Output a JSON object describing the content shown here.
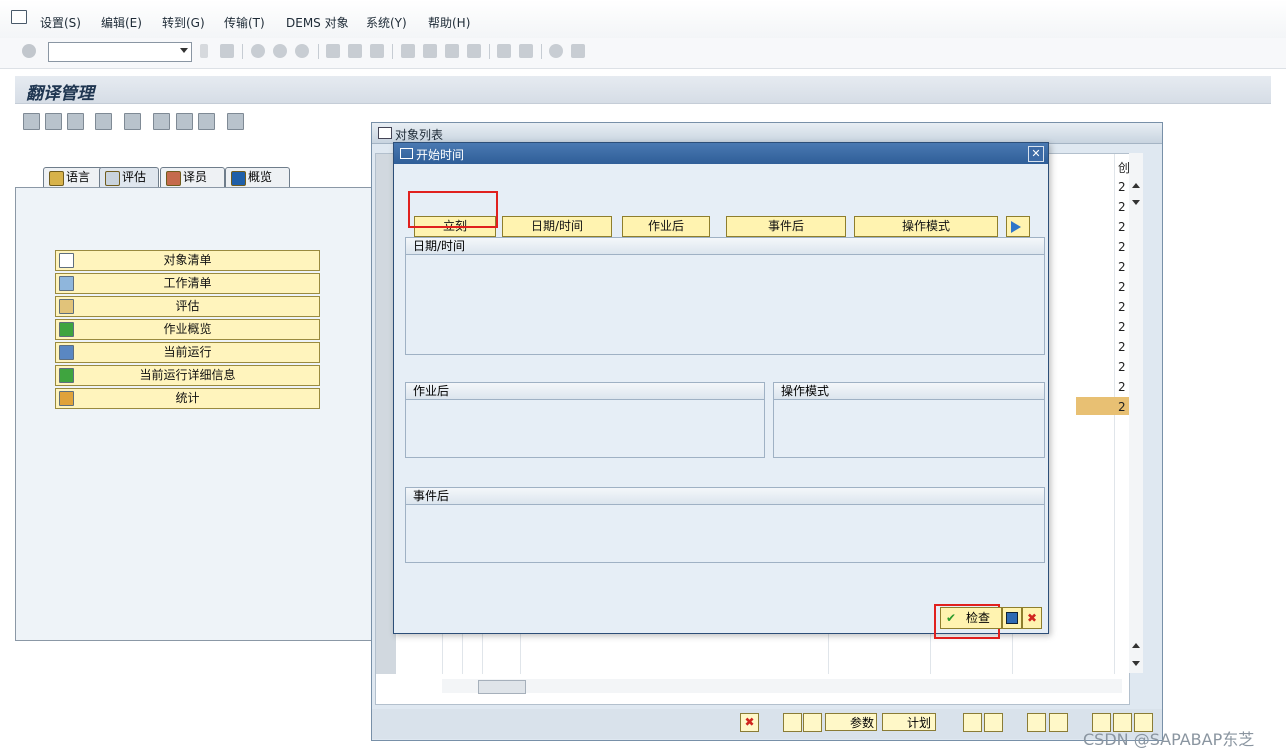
{
  "menu": {
    "items": [
      "设置(S)",
      "编辑(E)",
      "转到(G)",
      "传输(T)",
      "DEMS 对象",
      "系统(Y)",
      "帮助(H)"
    ]
  },
  "window": {
    "title": "翻译管理"
  },
  "tabs": [
    {
      "label": "语言",
      "icon": "language-icon"
    },
    {
      "label": "评估",
      "icon": "evaluation-icon"
    },
    {
      "label": "译员",
      "icon": "translators-icon"
    },
    {
      "label": "概览",
      "icon": "info-icon"
    }
  ],
  "nav": [
    {
      "label": "对象清单",
      "icon": "document-icon"
    },
    {
      "label": "工作清单",
      "icon": "worklist-icon"
    },
    {
      "label": "评估",
      "icon": "evaluation-icon"
    },
    {
      "label": "作业概览",
      "icon": "job-icon"
    },
    {
      "label": "当前运行",
      "icon": "run-icon"
    },
    {
      "label": "当前运行详细信息",
      "icon": "run-details-icon"
    },
    {
      "label": "统计",
      "icon": "statistics-icon"
    }
  ],
  "object_list": {
    "title": "对象列表",
    "col_header": "创",
    "cell_values": [
      "2",
      "2",
      "2",
      "2",
      "2",
      "2",
      "2",
      "2",
      "2",
      "2",
      "2",
      "2"
    ],
    "buttons": {
      "params": "参数",
      "plan": "计划"
    }
  },
  "dialog": {
    "title": "开始时间",
    "sched_buttons": [
      "立刻",
      "日期/时间",
      "作业后",
      "事件后",
      "操作模式"
    ],
    "groups": {
      "datetime": "日期/时间",
      "after_job": "作业后",
      "op_mode": "操作模式",
      "after_event": "事件后"
    },
    "check_label": "检查",
    "close_symbol": "✕",
    "cancel_symbol": "✖"
  },
  "watermark": "CSDN @SAPABAP东芝"
}
